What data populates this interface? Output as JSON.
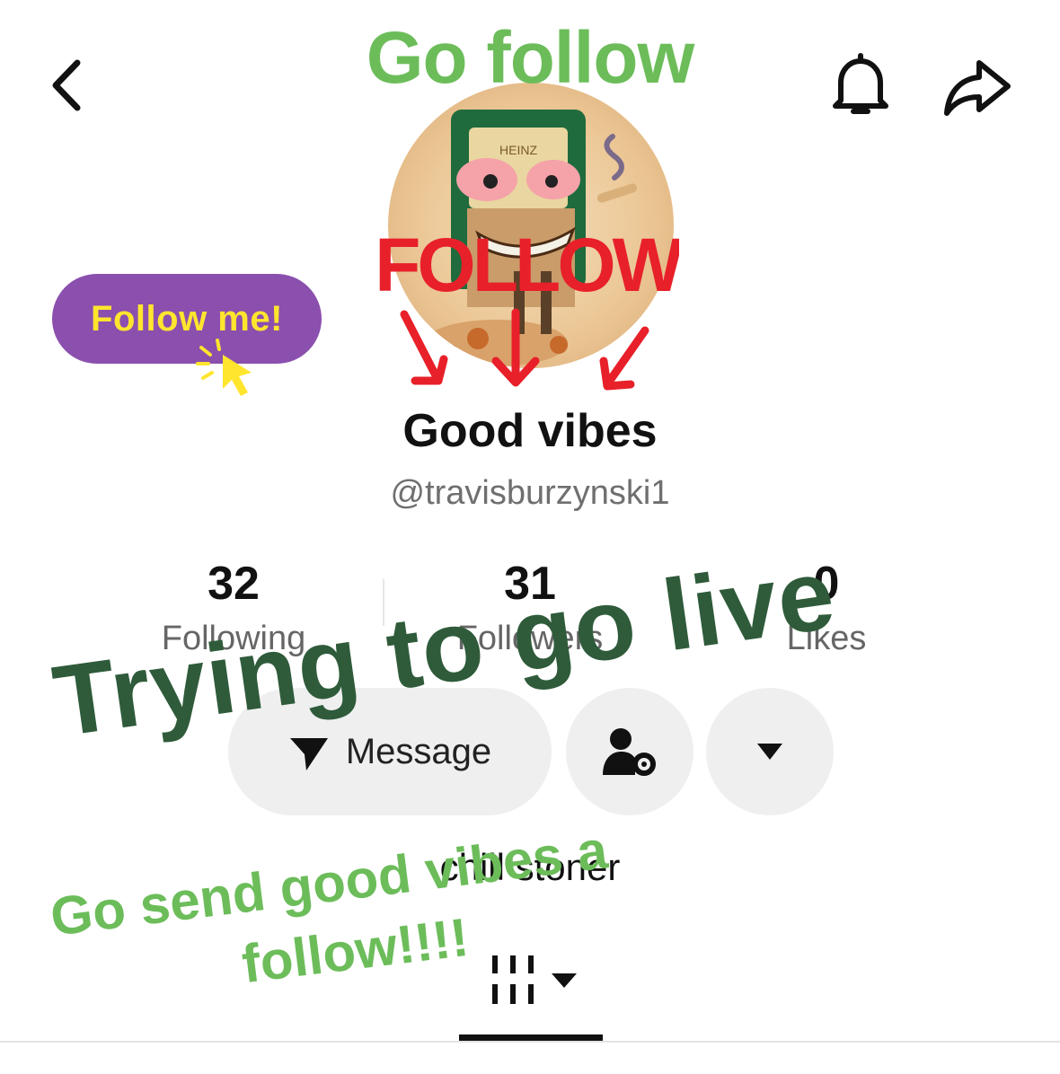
{
  "header": {
    "overlay_title": "Go follow"
  },
  "badge": {
    "label": "Follow me!"
  },
  "avatar": {
    "scribble_text": "FOLLOW"
  },
  "profile": {
    "name": "Good vibes",
    "handle": "@travisburzynski1",
    "bio": "chill stoner"
  },
  "stats": [
    {
      "value": "32",
      "label": "Following"
    },
    {
      "value": "31",
      "label": "Followers"
    },
    {
      "value": "0",
      "label": "Likes"
    }
  ],
  "actions": {
    "message_label": "Message"
  },
  "overlays": {
    "live": "Trying to go live",
    "bottom_line1": "Go send good vibes a",
    "bottom_line2": "follow!!!!"
  },
  "icons": {
    "back": "back-icon",
    "bell": "bell-icon",
    "share": "share-icon",
    "send": "send-icon",
    "user_settings": "user-settings-icon",
    "dropdown": "chevron-down-icon",
    "tab_grid": "grid-icon"
  },
  "colors": {
    "overlay_green": "#6cbd5a",
    "overlay_dark_green": "#2f5b3a",
    "badge_purple": "#8b4fae",
    "badge_yellow": "#ffe52e",
    "scribble_red": "#e8202a"
  }
}
